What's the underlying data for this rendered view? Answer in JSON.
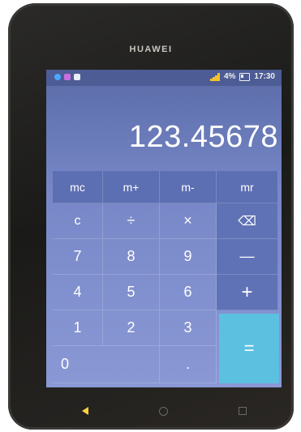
{
  "phone": {
    "brand": "HUAWEI"
  },
  "status": {
    "battery": "4%",
    "time": "17:30",
    "icons": [
      "notification-app-icon",
      "notification-app-icon",
      "notification-message-icon",
      "signal-icon",
      "battery-icon"
    ]
  },
  "display": {
    "value": "123.45678"
  },
  "keys": {
    "mc": "mc",
    "mplus": "m+",
    "mminus": "m-",
    "mr": "mr",
    "clear": "c",
    "divide": "÷",
    "multiply": "×",
    "backspace": "⌫",
    "seven": "7",
    "eight": "8",
    "nine": "9",
    "minus": "—",
    "four": "4",
    "five": "5",
    "six": "6",
    "plus": "+",
    "one": "1",
    "two": "2",
    "three": "3",
    "zero": "0",
    "decimal": ".",
    "equals": "="
  },
  "colors": {
    "screen": "#7787c7",
    "equals_key": "#5cc0e0",
    "signal": "#f4c12a"
  },
  "nav": {
    "icons": [
      "back-icon",
      "home-icon",
      "recent-apps-icon"
    ]
  }
}
